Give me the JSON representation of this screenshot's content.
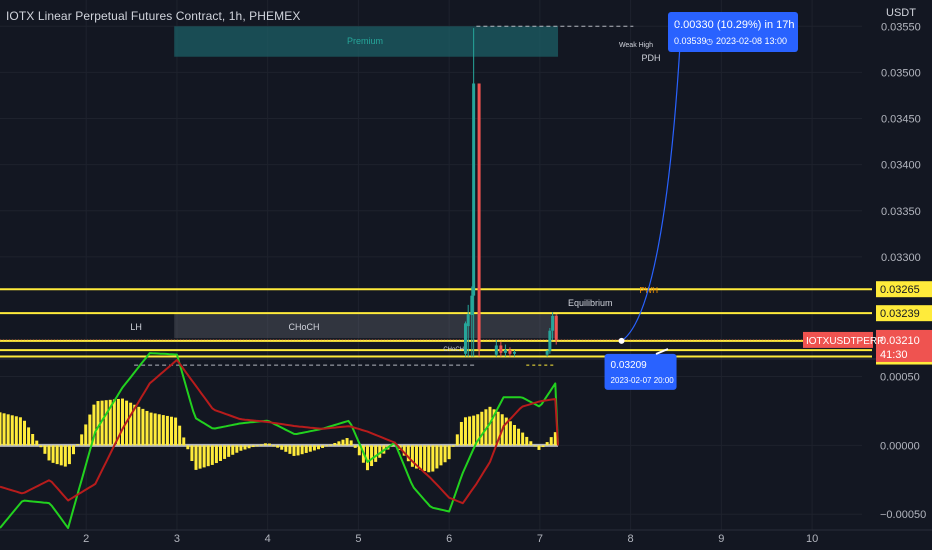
{
  "header": {
    "title": "IOTX Linear Perpetual Futures Contract, 1h, PHEMEX",
    "currency": "USDT"
  },
  "colors": {
    "background": "#131722",
    "bull": "#26a69a",
    "bear": "#ef5350",
    "level": "#ffeb3b",
    "projection": "#2962ff",
    "signal_green": "#22d11f",
    "signal_red": "#b71c1c",
    "histogram": "#ffeb3b"
  },
  "chart_data": [
    {
      "type": "candlestick",
      "title": "IOTX Linear Perpetual Futures Contract, 1h, PHEMEX",
      "x_ticks": [
        "2",
        "3",
        "4",
        "5",
        "6",
        "7",
        "8",
        "9",
        "10"
      ],
      "x_tick_values": [
        2,
        3,
        4,
        5,
        6,
        7,
        8,
        9,
        10
      ],
      "xlim": [
        1.05,
        10.55
      ],
      "ylim": [
        0.031915,
        0.035785
      ],
      "y_ticks": [
        0.0355,
        0.035,
        0.0345,
        0.034,
        0.0335,
        0.033
      ],
      "y_tick_labels": [
        "0.03550",
        "0.03500",
        "0.03450",
        "0.03400",
        "0.03350",
        "0.03300"
      ],
      "candles": [
        {
          "x": 6.18,
          "open": 0.03195,
          "high": 0.0323,
          "low": 0.03192,
          "close": 0.03228
        },
        {
          "x": 6.21,
          "open": 0.03225,
          "high": 0.03248,
          "low": 0.03192,
          "close": 0.03238
        },
        {
          "x": 6.25,
          "open": 0.03237,
          "high": 0.03268,
          "low": 0.03192,
          "close": 0.03258
        },
        {
          "x": 6.27,
          "open": 0.03258,
          "high": 0.03548,
          "low": 0.03192,
          "close": 0.03488
        },
        {
          "x": 6.33,
          "open": 0.03488,
          "high": 0.03488,
          "low": 0.03192,
          "close": 0.032
        },
        {
          "x": 6.52,
          "open": 0.03194,
          "high": 0.0321,
          "low": 0.03192,
          "close": 0.03204
        },
        {
          "x": 6.57,
          "open": 0.03204,
          "high": 0.03208,
          "low": 0.03192,
          "close": 0.03196
        },
        {
          "x": 6.62,
          "open": 0.03196,
          "high": 0.03205,
          "low": 0.03192,
          "close": 0.03199
        },
        {
          "x": 6.67,
          "open": 0.03199,
          "high": 0.03202,
          "low": 0.03192,
          "close": 0.03195
        },
        {
          "x": 6.72,
          "open": 0.03195,
          "high": 0.03199,
          "low": 0.03192,
          "close": 0.03197
        },
        {
          "x": 7.08,
          "open": 0.03194,
          "high": 0.03199,
          "low": 0.03192,
          "close": 0.03198
        },
        {
          "x": 7.11,
          "open": 0.03198,
          "high": 0.03223,
          "low": 0.03195,
          "close": 0.0322
        },
        {
          "x": 7.14,
          "open": 0.0322,
          "high": 0.0324,
          "low": 0.0321,
          "close": 0.03236
        },
        {
          "x": 7.18,
          "open": 0.03236,
          "high": 0.03238,
          "low": 0.03205,
          "close": 0.0321
        }
      ],
      "levels": [
        {
          "name": "yellow-level-1",
          "value": 0.03265,
          "label": "0.03265",
          "color": "#ffeb3b"
        },
        {
          "name": "yellow-level-2",
          "value": 0.03239,
          "label": "0.03239",
          "color": "#ffeb3b"
        },
        {
          "name": "yellow-level-3",
          "value": 0.03209,
          "label": "",
          "color": "#ffeb3b"
        },
        {
          "name": "yellow-level-4",
          "value": 0.03199,
          "label": "0.03199",
          "color": "#ffeb3b"
        },
        {
          "name": "yellow-level-5",
          "value": 0.03192,
          "label": "0.03192",
          "color": "#ffeb3b"
        }
      ],
      "current_price": {
        "label": "0.03210",
        "symbol": "IOTXUSDTPERP",
        "countdown": "41:30",
        "value": 0.0321
      },
      "zones": {
        "premium_label": "Premium",
        "premium_range": [
          0.03517,
          0.0355
        ],
        "premium_x": [
          2.97,
          7.2
        ],
        "equilibrium_label": "Equilibrium",
        "equilibrium_range": [
          0.03212,
          0.03238
        ],
        "equilibrium_x": [
          2.97,
          7.2
        ]
      },
      "annotations": {
        "weak_high": "Weak High",
        "pdh": "PDH",
        "pdh_value": 0.0355,
        "pdh_x": [
          6.3,
          8.03
        ],
        "pwh": "PWH",
        "pwh_x": 8.2,
        "lh": "LH",
        "lh_x": 2.55,
        "lh_value": 0.03199,
        "choch_1": "CHoCH",
        "choch_1_x": 4.4,
        "choch_2": "CHoCH",
        "choch_2_x": 6.05,
        "choch_value": 0.03199
      },
      "projection": {
        "start_value": 0.03209,
        "start_date": "2023-02-07 20:00",
        "start_label": "0.03209",
        "start_x": 7.9,
        "end_value": 0.03539,
        "end_date": "2023-02-08  13:00",
        "end_x": 8.55,
        "change_label": "0.00330 (10.29%) in 17h",
        "end_label": "0.03539",
        "clock_icon": "clock-icon"
      }
    },
    {
      "type": "line+histogram",
      "ylim": [
        -0.0006,
        0.00062
      ],
      "y_ticks": [
        0.0005,
        0.0,
        -0.0005
      ],
      "y_tick_labels": [
        "0.00050",
        "0.00000",
        "−0.00050"
      ],
      "series": [
        {
          "color": "#22d11f",
          "x": [
            1.05,
            1.3,
            1.6,
            1.8,
            2.1,
            2.4,
            2.7,
            3.0,
            3.2,
            3.4,
            3.7,
            4.0,
            4.3,
            4.6,
            4.9,
            5.1,
            5.4,
            5.6,
            5.8,
            6.0,
            6.15,
            6.3,
            6.45,
            6.6,
            6.8,
            7.0,
            7.2
          ],
          "y": [
            -0.0006,
            -0.0004,
            -0.00042,
            -0.0006,
            0.0001,
            0.00042,
            0.00067,
            0.00066,
            0.0002,
            0.00012,
            0.00016,
            0.00018,
            8e-05,
            0.00012,
            0.00018,
            -0.00012,
            2e-05,
            -0.0003,
            -0.00045,
            -0.00048,
            -0.0002,
            2e-05,
            0.00016,
            0.00035,
            0.00035,
            0.00028,
            0.00048
          ]
        },
        {
          "color": "#b71c1c",
          "x": [
            1.05,
            1.3,
            1.6,
            1.8,
            2.1,
            2.4,
            2.7,
            3.0,
            3.2,
            3.4,
            3.7,
            4.0,
            4.3,
            4.6,
            4.9,
            5.1,
            5.4,
            5.6,
            5.8,
            6.0,
            6.15,
            6.3,
            6.45,
            6.6,
            6.8,
            7.0,
            7.2
          ],
          "y": [
            -0.0003,
            -0.00035,
            -0.00025,
            -0.0004,
            -0.00028,
            0.00012,
            0.00045,
            0.00062,
            0.00044,
            0.00026,
            0.00019,
            0.00017,
            0.00014,
            0.00012,
            0.00014,
            0.0001,
            2e-05,
            -0.00012,
            -0.00024,
            -0.00038,
            -0.00042,
            -0.00028,
            -0.00012,
            0.00014,
            0.00028,
            0.00032,
            0.00034
          ]
        }
      ],
      "histogram": {
        "color": "#ffeb3b",
        "x": [
          1.05,
          1.3,
          1.6,
          1.8,
          2.1,
          2.4,
          2.7,
          3.0,
          3.2,
          3.4,
          3.7,
          4.0,
          4.3,
          4.6,
          4.9,
          5.1,
          5.4,
          5.6,
          5.8,
          6.0,
          6.15,
          6.3,
          6.45,
          6.6,
          6.8,
          7.0,
          7.2
        ],
        "y": [
          0.00024,
          0.0002,
          -0.00012,
          -0.00016,
          0.00032,
          0.00034,
          0.00024,
          0.0002,
          -0.00018,
          -0.00014,
          -4e-05,
          2e-05,
          -8e-05,
          -2e-05,
          6e-05,
          -0.00018,
          2e-05,
          -0.00016,
          -0.0002,
          -0.0001,
          0.0002,
          0.00022,
          0.00028,
          0.00022,
          0.0001,
          -4e-05,
          0.00012
        ]
      }
    }
  ]
}
